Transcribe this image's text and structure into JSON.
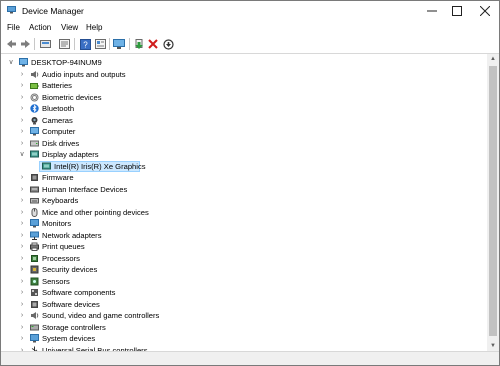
{
  "window": {
    "title": "Device Manager"
  },
  "menu": [
    "File",
    "Action",
    "View",
    "Help"
  ],
  "toolbar_icons": [
    "back-arrow-icon",
    "forward-arrow-icon",
    "show-hidden-icon",
    "properties-icon",
    "help-icon",
    "details-icon",
    "computer-monitor-icon",
    "update-driver-icon",
    "uninstall-x-icon",
    "download-icon"
  ],
  "tree": {
    "root": "DESKTOP-94INUM9",
    "items": [
      {
        "label": "Audio inputs and outputs",
        "icon": "speaker-icon",
        "expanded": false
      },
      {
        "label": "Batteries",
        "icon": "battery-icon",
        "expanded": false
      },
      {
        "label": "Biometric devices",
        "icon": "fingerprint-icon",
        "expanded": false
      },
      {
        "label": "Bluetooth",
        "icon": "bluetooth-icon",
        "expanded": false
      },
      {
        "label": "Cameras",
        "icon": "camera-icon",
        "expanded": false
      },
      {
        "label": "Computer",
        "icon": "computer-icon",
        "expanded": false
      },
      {
        "label": "Disk drives",
        "icon": "disk-drive-icon",
        "expanded": false
      },
      {
        "label": "Display adapters",
        "icon": "display-adapter-icon",
        "expanded": true,
        "children": [
          {
            "label": "Intel(R) Iris(R) Xe Graphics",
            "icon": "display-adapter-icon",
            "selected": true
          }
        ]
      },
      {
        "label": "Firmware",
        "icon": "firmware-icon",
        "expanded": false
      },
      {
        "label": "Human Interface Devices",
        "icon": "hid-icon",
        "expanded": false
      },
      {
        "label": "Keyboards",
        "icon": "keyboard-icon",
        "expanded": false
      },
      {
        "label": "Mice and other pointing devices",
        "icon": "mouse-icon",
        "expanded": false
      },
      {
        "label": "Monitors",
        "icon": "monitor-icon",
        "expanded": false
      },
      {
        "label": "Network adapters",
        "icon": "network-adapter-icon",
        "expanded": false
      },
      {
        "label": "Print queues",
        "icon": "printer-icon",
        "expanded": false
      },
      {
        "label": "Processors",
        "icon": "processor-icon",
        "expanded": false
      },
      {
        "label": "Security devices",
        "icon": "security-device-icon",
        "expanded": false
      },
      {
        "label": "Sensors",
        "icon": "sensor-icon",
        "expanded": false
      },
      {
        "label": "Software components",
        "icon": "software-component-icon",
        "expanded": false
      },
      {
        "label": "Software devices",
        "icon": "software-device-icon",
        "expanded": false
      },
      {
        "label": "Sound, video and game controllers",
        "icon": "sound-icon",
        "expanded": false
      },
      {
        "label": "Storage controllers",
        "icon": "storage-controller-icon",
        "expanded": false
      },
      {
        "label": "System devices",
        "icon": "system-device-icon",
        "expanded": false
      },
      {
        "label": "Universal Serial Bus controllers",
        "icon": "usb-icon",
        "expanded": false
      }
    ]
  },
  "colors": {
    "selection": "#cce8ff",
    "selection_border": "#99d1ff"
  }
}
